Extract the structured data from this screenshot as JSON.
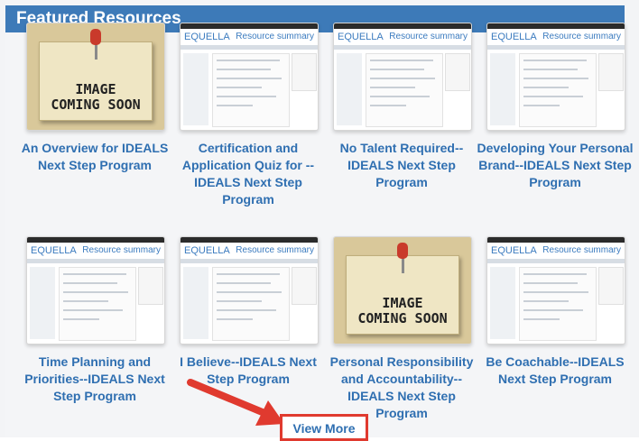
{
  "header": {
    "title": "Featured Resources"
  },
  "resources": [
    {
      "title": "An Overview for IDEALS Next Step Program",
      "thumbnail": "placeholder"
    },
    {
      "title": "Certification and Application Quiz for -- IDEALS Next Step Program",
      "thumbnail": "equella"
    },
    {
      "title": "No Talent Required--IDEALS Next Step Program",
      "thumbnail": "equella"
    },
    {
      "title": "Developing Your Personal Brand--IDEALS Next Step Program",
      "thumbnail": "equella"
    },
    {
      "title": "Time Planning and Priorities--IDEALS Next Step Program",
      "thumbnail": "equella"
    },
    {
      "title": "I Believe--IDEALS Next Step Program",
      "thumbnail": "equella"
    },
    {
      "title": "Personal Responsibility and Accountability--IDEALS Next Step Program",
      "thumbnail": "placeholder"
    },
    {
      "title": "Be Coachable--IDEALS Next Step Program",
      "thumbnail": "equella"
    }
  ],
  "placeholder": {
    "line1": "IMAGE",
    "line2": "COMING SOON"
  },
  "equella_thumb": {
    "logo": "EQUELLA",
    "title": "Resource summary"
  },
  "view_more": {
    "label": "View More"
  },
  "colors": {
    "header": "#3d7ab8",
    "link": "#2f6fb1",
    "highlight": "#e03a2f"
  }
}
